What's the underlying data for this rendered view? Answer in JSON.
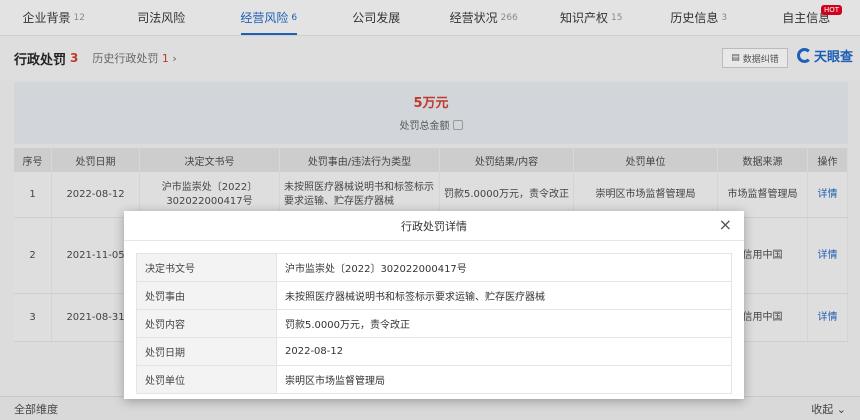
{
  "nav": {
    "tabs": [
      {
        "label": "企业背景",
        "count": "12"
      },
      {
        "label": "司法风险",
        "count": ""
      },
      {
        "label": "经营风险",
        "count": "6"
      },
      {
        "label": "公司发展",
        "count": ""
      },
      {
        "label": "经营状况",
        "count": "266"
      },
      {
        "label": "知识产权",
        "count": "15"
      },
      {
        "label": "历史信息",
        "count": "3"
      },
      {
        "label": "自主信息",
        "count": ""
      }
    ],
    "hot_badge": "HOT",
    "active_color": "#1d5fb4"
  },
  "section": {
    "title": "行政处罚",
    "count": "3",
    "history_label": "历史行政处罚",
    "history_count": "1",
    "history_arrow": "›",
    "download_label": "数据纠错",
    "logo_text": "天眼查"
  },
  "summary": {
    "amount": "5万元",
    "label": "处罚总金额"
  },
  "table": {
    "headers": [
      "序号",
      "处罚日期",
      "决定文书号",
      "处罚事由/违法行为类型",
      "处罚结果/内容",
      "处罚单位",
      "数据来源",
      "操作"
    ],
    "rows": [
      {
        "no": "1",
        "date": "2022-08-12",
        "doc": "沪市监崇处〔2022〕302022000417号",
        "reason": "未按照医疗器械说明书和标签标示要求运输、贮存医疗器械",
        "result": "罚款5.0000万元，责令改正",
        "unit": "崇明区市场监督管理局",
        "source": "市场监督管理局",
        "action": "详情"
      },
      {
        "no": "2",
        "date": "2021-11-05",
        "doc": "",
        "reason": "",
        "result": "",
        "unit": "",
        "source": "信用中国",
        "action": "详情"
      },
      {
        "no": "3",
        "date": "2021-08-31",
        "doc": "",
        "reason": "",
        "result": "",
        "unit": "",
        "source": "信用中国",
        "action": "详情"
      }
    ]
  },
  "footer": {
    "left": "全部维度",
    "right": "收起"
  },
  "modal": {
    "title": "行政处罚详情",
    "close": "×",
    "fields": [
      {
        "key": "决定书文号",
        "value": "沪市监崇处〔2022〕302022000417号"
      },
      {
        "key": "处罚事由",
        "value": "未按照医疗器械说明书和标签标示要求运输、贮存医疗器械"
      },
      {
        "key": "处罚内容",
        "value": "罚款5.0000万元，责令改正"
      },
      {
        "key": "处罚日期",
        "value": "2022-08-12"
      },
      {
        "key": "处罚单位",
        "value": "崇明区市场监督管理局"
      }
    ]
  }
}
